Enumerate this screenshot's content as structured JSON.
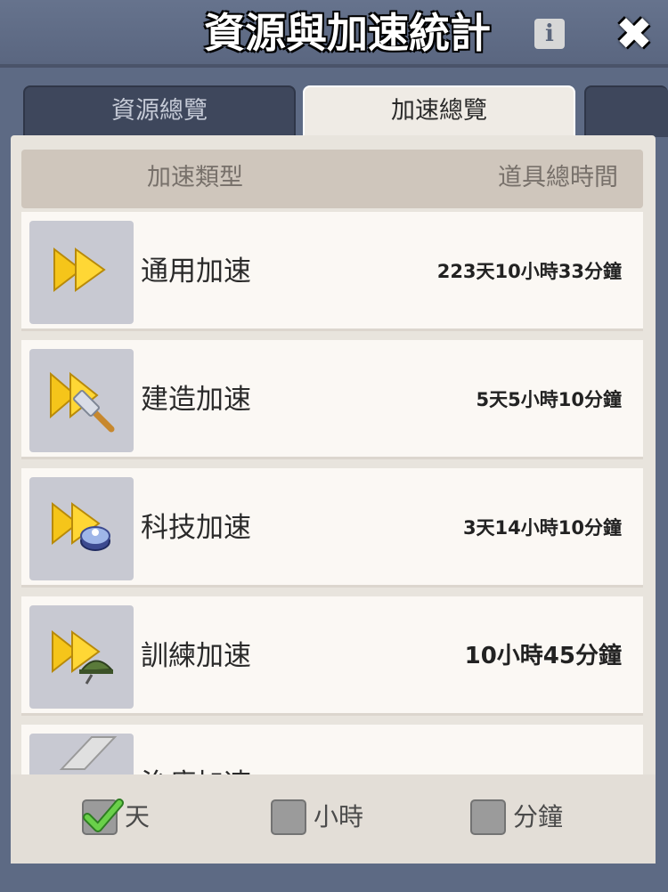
{
  "header": {
    "title": "資源與加速統計",
    "info_icon": "info-icon",
    "close_icon": "close-icon"
  },
  "tabs": [
    {
      "label": "資源總覽",
      "active": false
    },
    {
      "label": "加速總覽",
      "active": true
    }
  ],
  "table": {
    "column_type": "加速類型",
    "column_time": "道具總時間"
  },
  "rows": [
    {
      "icon": "speedup-general-icon",
      "label": "通用加速",
      "time": "223天10小時33分鐘"
    },
    {
      "icon": "speedup-build-hammer-icon",
      "label": "建造加速",
      "time": "5天5小時10分鐘"
    },
    {
      "icon": "speedup-research-flask-icon",
      "label": "科技加速",
      "time": "3天14小時10分鐘"
    },
    {
      "icon": "speedup-training-helmet-icon",
      "label": "訓練加速",
      "time": "10小時45分鐘"
    },
    {
      "icon": "speedup-healing-icon",
      "label": "治療加速",
      "time": ""
    }
  ],
  "footer": {
    "options": [
      {
        "label": "天",
        "checked": true
      },
      {
        "label": "小時",
        "checked": false
      },
      {
        "label": "分鐘",
        "checked": false
      }
    ]
  },
  "colors": {
    "background": "#5d6a84",
    "panel": "#e8e4dd",
    "row": "#fbf8f4",
    "accent_yellow": "#f5c51a",
    "check_green": "#4caf3a"
  }
}
